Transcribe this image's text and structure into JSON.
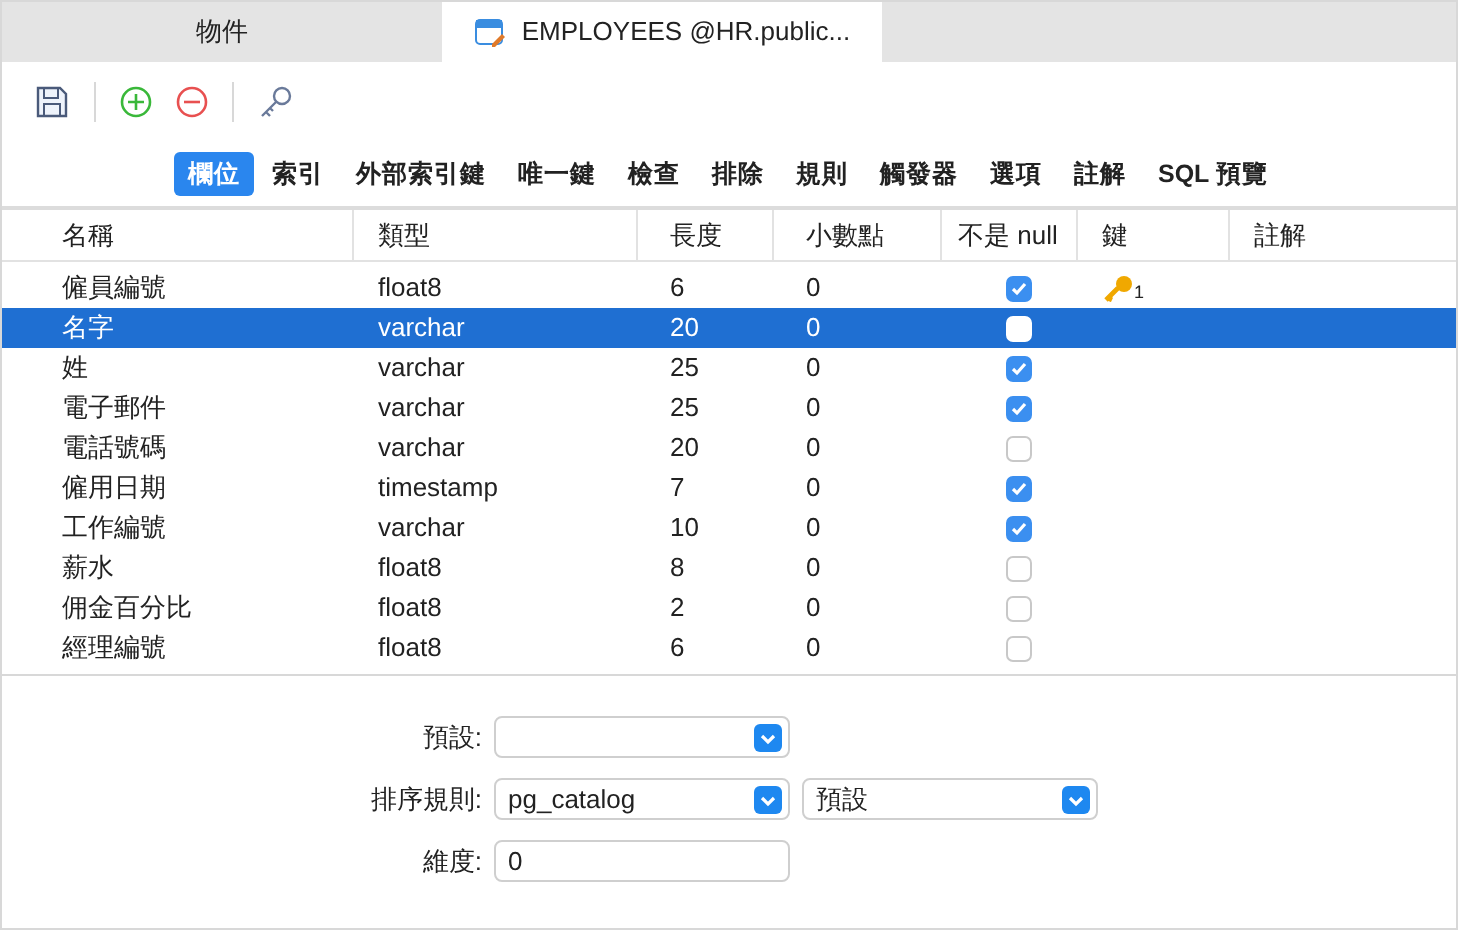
{
  "tabs": [
    {
      "label": "物件",
      "selected": false
    },
    {
      "label": "EMPLOYEES @HR.public...",
      "selected": true
    }
  ],
  "subtabs": [
    {
      "label": "欄位",
      "selected": true
    },
    {
      "label": "索引",
      "selected": false
    },
    {
      "label": "外部索引鍵",
      "selected": false
    },
    {
      "label": "唯一鍵",
      "selected": false
    },
    {
      "label": "檢查",
      "selected": false
    },
    {
      "label": "排除",
      "selected": false
    },
    {
      "label": "規則",
      "selected": false
    },
    {
      "label": "觸發器",
      "selected": false
    },
    {
      "label": "選項",
      "selected": false
    },
    {
      "label": "註解",
      "selected": false
    },
    {
      "label": "SQL 預覽",
      "selected": false
    }
  ],
  "columns": [
    "名稱",
    "類型",
    "長度",
    "小數點",
    "不是 null",
    "鍵",
    "註解"
  ],
  "rows": [
    {
      "name": "僱員編號",
      "type": "float8",
      "length": "6",
      "decimal": "0",
      "not_null": true,
      "key": "1",
      "selected": false
    },
    {
      "name": "名字",
      "type": "varchar",
      "length": "20",
      "decimal": "0",
      "not_null": false,
      "selected": true
    },
    {
      "name": "姓",
      "type": "varchar",
      "length": "25",
      "decimal": "0",
      "not_null": true,
      "selected": false
    },
    {
      "name": "電子郵件",
      "type": "varchar",
      "length": "25",
      "decimal": "0",
      "not_null": true,
      "selected": false
    },
    {
      "name": "電話號碼",
      "type": "varchar",
      "length": "20",
      "decimal": "0",
      "not_null": false,
      "selected": false
    },
    {
      "name": "僱用日期",
      "type": "timestamp",
      "length": "7",
      "decimal": "0",
      "not_null": true,
      "selected": false
    },
    {
      "name": "工作編號",
      "type": "varchar",
      "length": "10",
      "decimal": "0",
      "not_null": true,
      "selected": false
    },
    {
      "name": "薪水",
      "type": "float8",
      "length": "8",
      "decimal": "0",
      "not_null": false,
      "selected": false
    },
    {
      "name": "佣金百分比",
      "type": "float8",
      "length": "2",
      "decimal": "0",
      "not_null": false,
      "selected": false
    },
    {
      "name": "經理編號",
      "type": "float8",
      "length": "6",
      "decimal": "0",
      "not_null": false,
      "selected": false
    }
  ],
  "properties": [
    {
      "label": "預設:",
      "fields": [
        {
          "kind": "select"
        }
      ]
    },
    {
      "label": "排序規則:",
      "fields": [
        {
          "kind": "select",
          "value": "pg_catalog"
        },
        {
          "kind": "select",
          "value": "預設"
        }
      ]
    },
    {
      "label": "維度:",
      "fields": [
        {
          "kind": "input",
          "value": "0"
        }
      ]
    }
  ]
}
